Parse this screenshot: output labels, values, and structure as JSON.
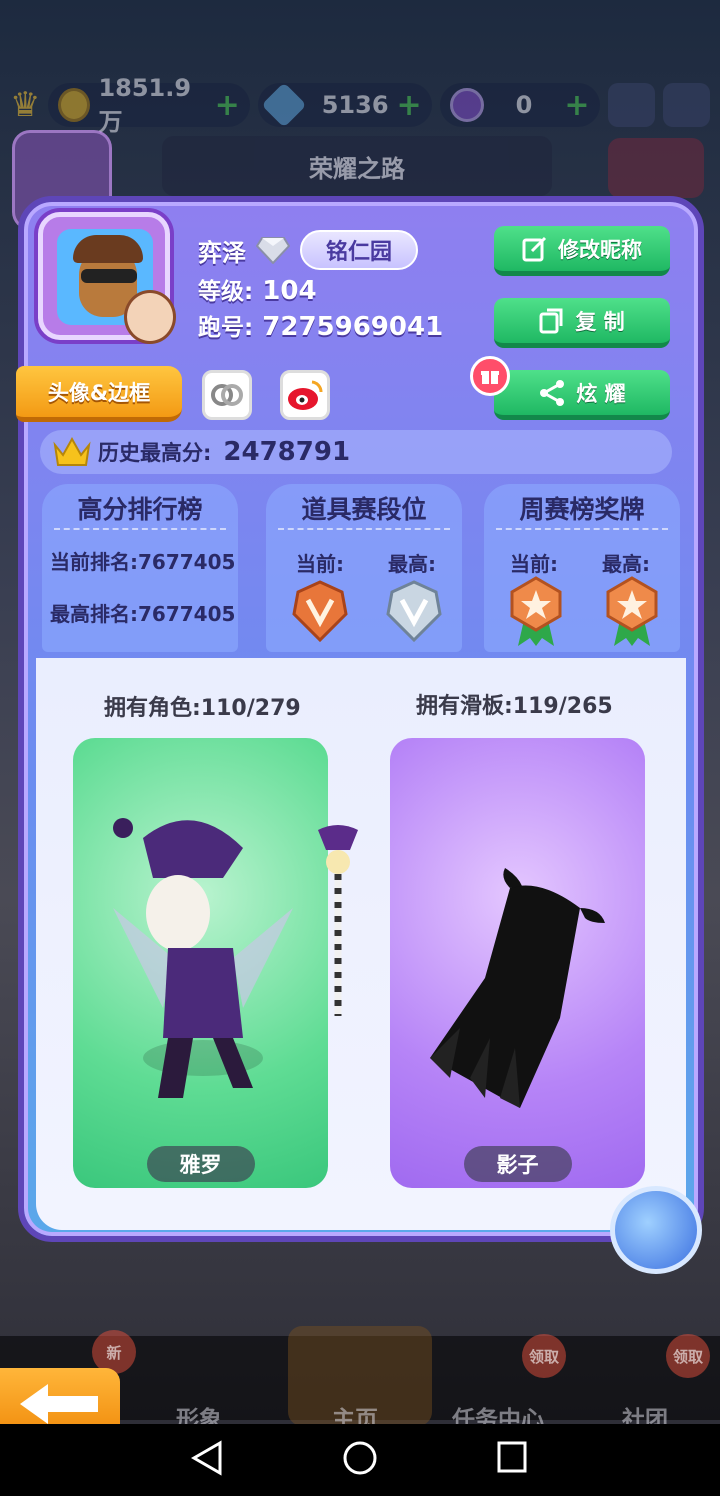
{
  "background": {
    "currency": {
      "coins": "1851.9万",
      "keys": "5136",
      "orbs": "0"
    },
    "banner_title": "荣耀之路"
  },
  "profile": {
    "name": "弈泽",
    "school": "铭仁园",
    "level_label": "等级:",
    "level_value": "104",
    "runner_id_label": "跑号:",
    "runner_id_value": "7275969041"
  },
  "actions": {
    "edit_nickname": "修改昵称",
    "copy": "复 制",
    "show_off": "炫 耀",
    "avatar_frame": "头像&边框"
  },
  "high_score": {
    "label": "历史最高分:",
    "value": "2478791"
  },
  "panels": {
    "leaderboard": {
      "title": "高分排行榜",
      "current_rank": "当前排名:7677405",
      "best_rank": "最高排名:7677405"
    },
    "item_tier": {
      "title": "道具赛段位",
      "current_label": "当前:",
      "best_label": "最高:"
    },
    "weekly_medal": {
      "title": "周赛榜奖牌",
      "current_label": "当前:",
      "best_label": "最高:"
    }
  },
  "collection": {
    "characters_label": "拥有角色:110/279",
    "boards_label": "拥有滑板:119/265",
    "character_name": "雅罗",
    "board_name": "影子"
  },
  "bottom_nav": {
    "items": [
      "形象",
      "主页",
      "任务中心",
      "社团"
    ],
    "tags": [
      "新",
      "领取",
      "领取"
    ]
  },
  "colors": {
    "card_purple": "#8f7ff0",
    "button_green": "#1fb863",
    "button_orange": "#f39a14",
    "text_dark": "#2a2a66"
  }
}
